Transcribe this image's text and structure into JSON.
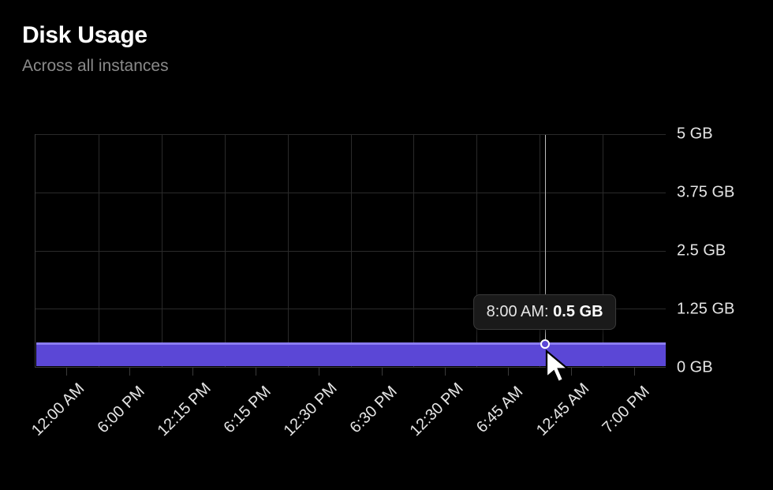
{
  "header": {
    "title": "Disk Usage",
    "subtitle": "Across all instances"
  },
  "tooltip": {
    "time": "8:00 AM",
    "value": "0.5 GB"
  },
  "chart_data": {
    "type": "area",
    "title": "Disk Usage",
    "subtitle": "Across all instances",
    "ylabel": "",
    "xlabel": "",
    "ylim": [
      0,
      5
    ],
    "y_unit": "GB",
    "y_ticks": [
      "0 GB",
      "1.25 GB",
      "2.5 GB",
      "3.75 GB",
      "5 GB"
    ],
    "categories": [
      "12:00 AM",
      "6:00 PM",
      "12:15 PM",
      "6:15 PM",
      "12:30 PM",
      "6:30 PM",
      "12:30 PM",
      "6:45 AM",
      "12:45 AM",
      "7:00 PM"
    ],
    "series": [
      {
        "name": "Disk Usage",
        "values": [
          0.5,
          0.5,
          0.5,
          0.5,
          0.5,
          0.5,
          0.5,
          0.5,
          0.5,
          0.5
        ]
      }
    ],
    "hover": {
      "category": "8:00 AM",
      "value": 0.5,
      "x_fraction": 0.808
    },
    "colors": {
      "fill": "#5b47d6",
      "line": "#8a7cf0"
    }
  }
}
